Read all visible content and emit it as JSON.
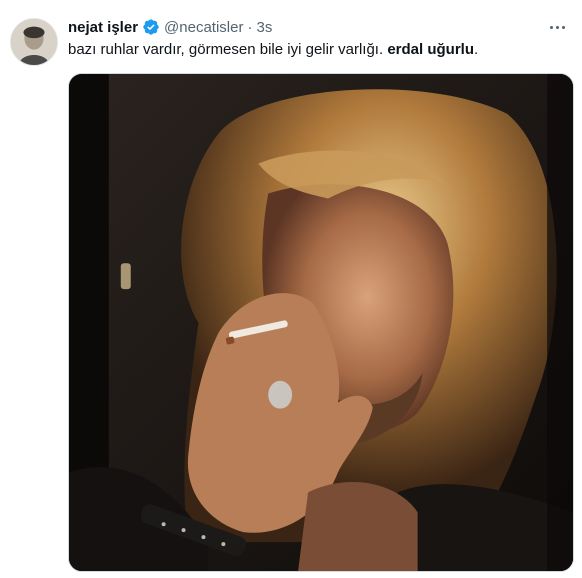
{
  "tweet": {
    "author_name": "nejat işler",
    "handle": "@necatisler",
    "separator": "·",
    "time": "3s",
    "text_plain": "bazı ruhlar vardır, görmesen bile iyi gelir varlığı. ",
    "text_bold": "erdal uğurlu",
    "text_end": "."
  },
  "icons": {
    "verified": "verified-badge-icon",
    "more": "more-options-icon"
  },
  "colors": {
    "verified_blue": "#1d9bf0",
    "secondary_text": "#536471",
    "primary_text": "#0f1419",
    "border": "#cfd9de"
  }
}
